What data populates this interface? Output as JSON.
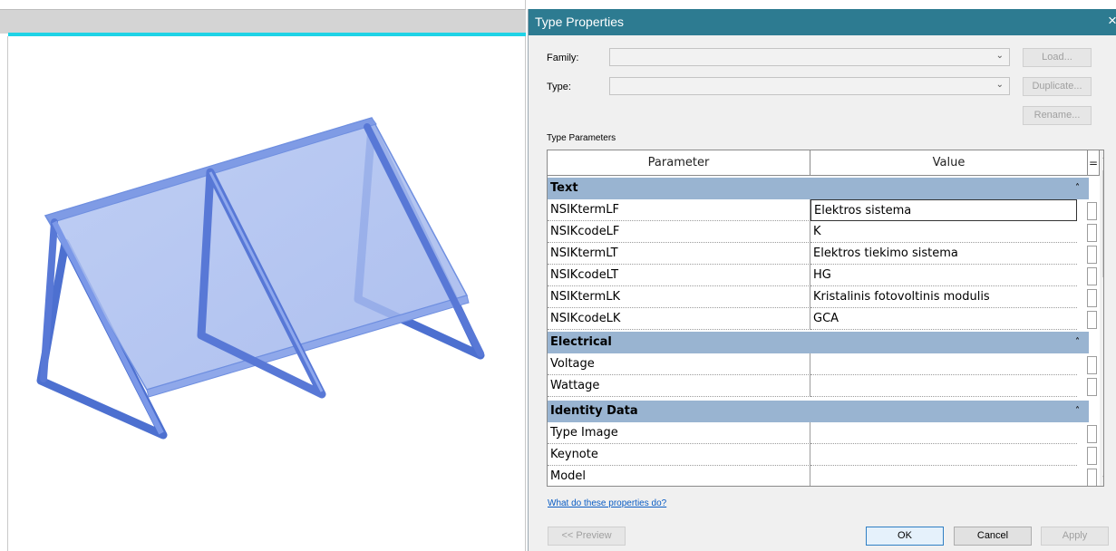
{
  "dialog": {
    "title": "Type Properties",
    "close_glyph": "×",
    "family_label": "Family:",
    "family_value": "",
    "type_label": "Type:",
    "type_value": "",
    "load_label": "Load...",
    "duplicate_label": "Duplicate...",
    "rename_label": "Rename...",
    "type_parameters_label": "Type Parameters",
    "help_link": "What do these properties do?",
    "preview_label": "<< Preview",
    "ok_label": "OK",
    "cancel_label": "Cancel",
    "apply_label": "Apply"
  },
  "grid": {
    "header_parameter": "Parameter",
    "header_value": "Value",
    "header_eq": "=",
    "groups": [
      {
        "name": "Text",
        "rows": [
          {
            "parameter": "NSIKtermLF",
            "value": "Elektros sistema"
          },
          {
            "parameter": "NSIKcodeLF",
            "value": "K"
          },
          {
            "parameter": "NSIKtermLT",
            "value": "Elektros tiekimo sistema"
          },
          {
            "parameter": "NSIKcodeLT",
            "value": "HG"
          },
          {
            "parameter": "NSIKtermLK",
            "value": "Kristalinis fotovoltinis modulis"
          },
          {
            "parameter": "NSIKcodeLK",
            "value": "GCA"
          }
        ]
      },
      {
        "name": "Electrical",
        "rows": [
          {
            "parameter": "Voltage",
            "value": ""
          },
          {
            "parameter": "Wattage",
            "value": ""
          }
        ]
      },
      {
        "name": "Identity Data",
        "rows": [
          {
            "parameter": "Type Image",
            "value": ""
          },
          {
            "parameter": "Keynote",
            "value": ""
          },
          {
            "parameter": "Model",
            "value": ""
          }
        ]
      }
    ]
  },
  "colors": {
    "titlebar": "#2d7b91",
    "group_header": "#99b4d1",
    "panel_fill": "#a9bdf0",
    "frame": "#5d7fd9",
    "viewport_tab_line": "#1fd3e6"
  }
}
